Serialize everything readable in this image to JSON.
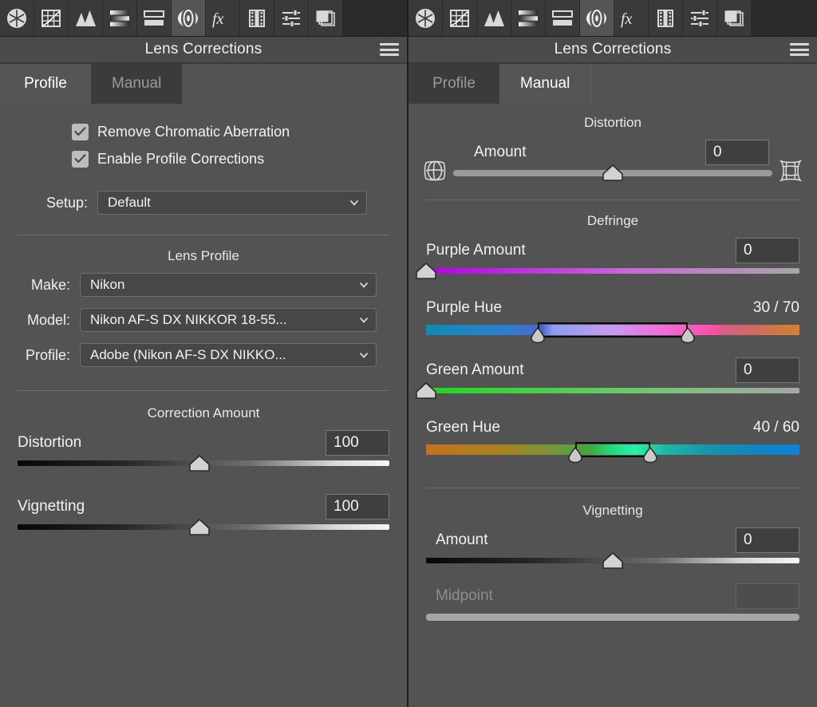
{
  "app": {
    "title": "Lens Corrections",
    "toolbar_icons": [
      "aperture-basic-icon",
      "tone-curve-icon",
      "detail-icon",
      "hsl-grayscale-icon",
      "split-toning-icon",
      "lens-corrections-icon",
      "effects-fx-icon",
      "camera-calibration-icon",
      "presets-sliders-icon",
      "snapshots-layers-icon"
    ],
    "menu_icon": "hamburger-menu-icon"
  },
  "left_panel": {
    "title": "Lens Corrections",
    "tabs": [
      {
        "label": "Profile",
        "active": true
      },
      {
        "label": "Manual",
        "active": false
      }
    ],
    "checkboxes": [
      {
        "label": "Remove Chromatic Aberration",
        "checked": true
      },
      {
        "label": "Enable Profile Corrections",
        "checked": true
      }
    ],
    "setup": {
      "label": "Setup:",
      "value": "Default"
    },
    "lens_profile": {
      "heading": "Lens Profile",
      "fields": [
        {
          "label": "Make:",
          "value": "Nikon"
        },
        {
          "label": "Model:",
          "value": "Nikon AF-S DX NIKKOR 18-55..."
        },
        {
          "label": "Profile:",
          "value": "Adobe (Nikon AF-S DX NIKKO..."
        }
      ]
    },
    "correction_amount": {
      "heading": "Correction Amount",
      "sliders": [
        {
          "label": "Distortion",
          "value": "100",
          "knob_pct": 49
        },
        {
          "label": "Vignetting",
          "value": "100",
          "knob_pct": 49
        }
      ]
    }
  },
  "right_panel": {
    "title": "Lens Corrections",
    "tabs": [
      {
        "label": "Profile",
        "active": false
      },
      {
        "label": "Manual",
        "active": true
      }
    ],
    "distortion": {
      "heading": "Distortion",
      "slider": {
        "label": "Amount",
        "value": "0",
        "knob_pct": 50
      },
      "left_icon": "barrel-distortion-icon",
      "right_icon": "pincushion-distortion-icon"
    },
    "defringe": {
      "heading": "Defringe",
      "purple_amount": {
        "label": "Purple Amount",
        "value": "0",
        "knob_pct": 0
      },
      "purple_hue": {
        "label": "Purple Hue",
        "value": "30 / 70",
        "low_pct": 30,
        "high_pct": 70
      },
      "green_amount": {
        "label": "Green Amount",
        "value": "0",
        "knob_pct": 0
      },
      "green_hue": {
        "label": "Green Hue",
        "value": "40 / 60",
        "low_pct": 40,
        "high_pct": 60
      }
    },
    "vignetting": {
      "heading": "Vignetting",
      "amount": {
        "label": "Amount",
        "value": "0",
        "knob_pct": 50
      },
      "midpoint": {
        "label": "Midpoint",
        "value": "",
        "disabled": true
      }
    }
  },
  "colors": {
    "panel_bg": "#535353",
    "toolbar_bg": "#2b2b2b",
    "tab_active": "#555555",
    "tab_inactive": "#3b3b3b",
    "text": "#f2f2f2",
    "text_dim": "#9b9b9b",
    "field_bg": "#474747",
    "purple_accent": "#b400e6",
    "green_accent": "#1ed81e"
  }
}
